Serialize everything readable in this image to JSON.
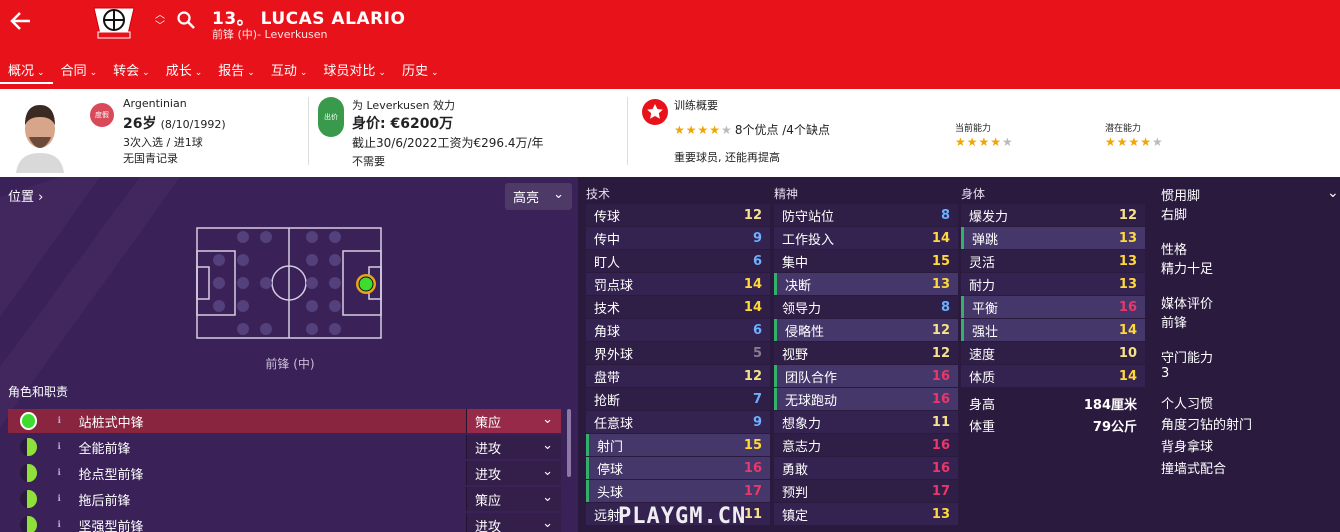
{
  "header": {
    "number": "13。",
    "name": "LUCAS ALARIO",
    "subtitle": "前锋 (中)- Leverkusen",
    "tabs": [
      {
        "label": "概况",
        "active": true
      },
      {
        "label": "合同"
      },
      {
        "label": "转会"
      },
      {
        "label": "成长"
      },
      {
        "label": "报告"
      },
      {
        "label": "互动"
      },
      {
        "label": "球员对比"
      },
      {
        "label": "历史"
      }
    ]
  },
  "info": {
    "nationality": "Argentinian",
    "nat_badge": "度假",
    "age": "26岁",
    "dob": "(8/10/1992)",
    "caps": "3次入选 / 进1球",
    "youth": "无国青记录",
    "club_line": "为 Leverkusen 效力",
    "club_badge": "出价",
    "value": "身价: €6200万",
    "contract": "截止30/6/2022工资为€296.4万/年",
    "not_needed": "不需要",
    "training_title": "训练概要",
    "pros_cons": "8个优点 /4个缺点",
    "training_stars": 3.5,
    "status": "重要球员, 还能再提高",
    "ca_label": "当前能力",
    "ca_stars": 3.5,
    "pa_label": "潜在能力",
    "pa_stars": 4
  },
  "position": {
    "title": "位置",
    "dropdown": "高亮",
    "label": "前锋 (中)"
  },
  "roles": {
    "title": "角色和职责",
    "items": [
      {
        "name": "站桩式中锋",
        "duty": "策应",
        "selected": true
      },
      {
        "name": "全能前锋",
        "duty": "进攻"
      },
      {
        "name": "抢点型前锋",
        "duty": "进攻"
      },
      {
        "name": "拖后前锋",
        "duty": "策应"
      },
      {
        "name": "坚强型前锋",
        "duty": "进攻"
      }
    ]
  },
  "attributes": {
    "technical": {
      "title": "技术",
      "items": [
        {
          "name": "传球",
          "value": "12"
        },
        {
          "name": "传中",
          "value": "9"
        },
        {
          "name": "盯人",
          "value": "6"
        },
        {
          "name": "罚点球",
          "value": "14"
        },
        {
          "name": "技术",
          "value": "14"
        },
        {
          "name": "角球",
          "value": "6"
        },
        {
          "name": "界外球",
          "value": "5"
        },
        {
          "name": "盘带",
          "value": "12"
        },
        {
          "name": "抢断",
          "value": "7"
        },
        {
          "name": "任意球",
          "value": "9"
        },
        {
          "name": "射门",
          "value": "15",
          "key": true
        },
        {
          "name": "停球",
          "value": "16",
          "key": true
        },
        {
          "name": "头球",
          "value": "17",
          "key": true
        },
        {
          "name": "远射",
          "value": "11"
        }
      ]
    },
    "mental": {
      "title": "精神",
      "items": [
        {
          "name": "防守站位",
          "value": "8"
        },
        {
          "name": "工作投入",
          "value": "14"
        },
        {
          "name": "集中",
          "value": "15"
        },
        {
          "name": "决断",
          "value": "13",
          "key": true
        },
        {
          "name": "领导力",
          "value": "8"
        },
        {
          "name": "侵略性",
          "value": "12",
          "key": true
        },
        {
          "name": "视野",
          "value": "12"
        },
        {
          "name": "团队合作",
          "value": "16",
          "key": true
        },
        {
          "name": "无球跑动",
          "value": "16",
          "key": true
        },
        {
          "name": "想象力",
          "value": "11"
        },
        {
          "name": "意志力",
          "value": "16"
        },
        {
          "name": "勇敢",
          "value": "16"
        },
        {
          "name": "预判",
          "value": "17"
        },
        {
          "name": "镇定",
          "value": "13"
        }
      ]
    },
    "physical": {
      "title": "身体",
      "items": [
        {
          "name": "爆发力",
          "value": "12"
        },
        {
          "name": "弹跳",
          "value": "13",
          "key": true
        },
        {
          "name": "灵活",
          "value": "13"
        },
        {
          "name": "耐力",
          "value": "13"
        },
        {
          "name": "平衡",
          "value": "16",
          "key": true
        },
        {
          "name": "强壮",
          "value": "14",
          "key": true
        },
        {
          "name": "速度",
          "value": "10"
        },
        {
          "name": "体质",
          "value": "14"
        }
      ],
      "height_label": "身高",
      "height": "184厘米",
      "weight_label": "体重",
      "weight": "79公斤"
    }
  },
  "side": {
    "foot_label": "惯用脚",
    "foot": "右脚",
    "personality_label": "性格",
    "personality": "精力十足",
    "media_label": "媒体评价",
    "media": "前锋",
    "gk_label": "守门能力",
    "gk": "3",
    "habits_label": "个人习惯",
    "habits": [
      "角度刁钻的射门",
      "背身拿球",
      "撞墙式配合"
    ]
  },
  "watermark": "PLAYGM.CN",
  "colors": {
    "header": "#e8121a",
    "panel": "#3a2157",
    "accent_green": "#35b06a"
  }
}
